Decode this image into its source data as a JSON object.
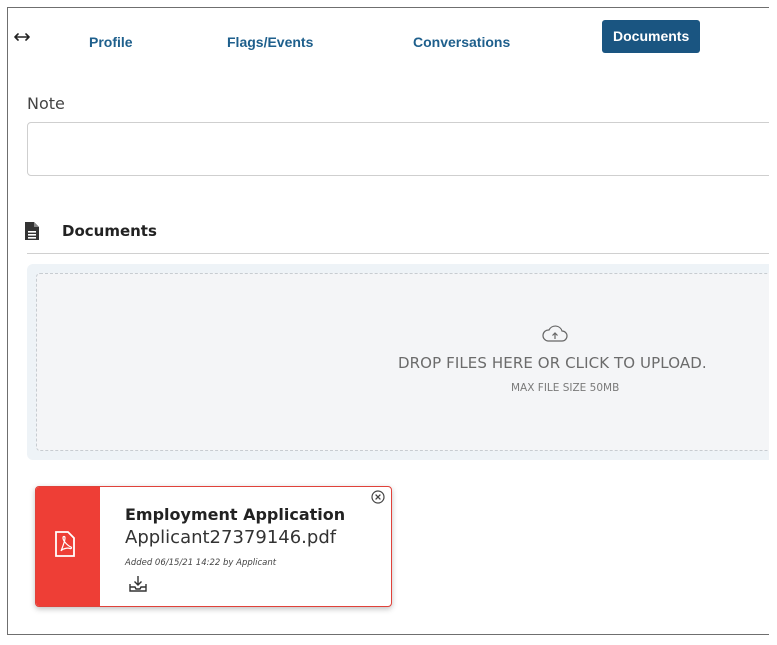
{
  "tabs": [
    {
      "label": "Profile",
      "active": false
    },
    {
      "label": "Flags/Events",
      "active": false
    },
    {
      "label": "Conversations",
      "active": false
    },
    {
      "label": "Documents",
      "active": true
    }
  ],
  "note": {
    "label": "Note",
    "value": ""
  },
  "documents_section": {
    "title": "Documents",
    "icon": "file-text-icon"
  },
  "dropzone": {
    "icon": "cloud-upload-icon",
    "message": "DROP FILES HERE OR CLICK TO UPLOAD.",
    "max_size": "MAX FILE SIZE 50MB"
  },
  "files": [
    {
      "type": "Employment Application",
      "filename": "Applicant27379146.pdf",
      "meta": "Added 06/15/21 14:22 by Applicant",
      "icon": "pdf-file-icon",
      "accent": "#ee3e36"
    }
  ],
  "colors": {
    "tab_text": "#1e5f8c",
    "tab_active_bg": "#1a5581",
    "file_accent": "#ee3e36"
  }
}
